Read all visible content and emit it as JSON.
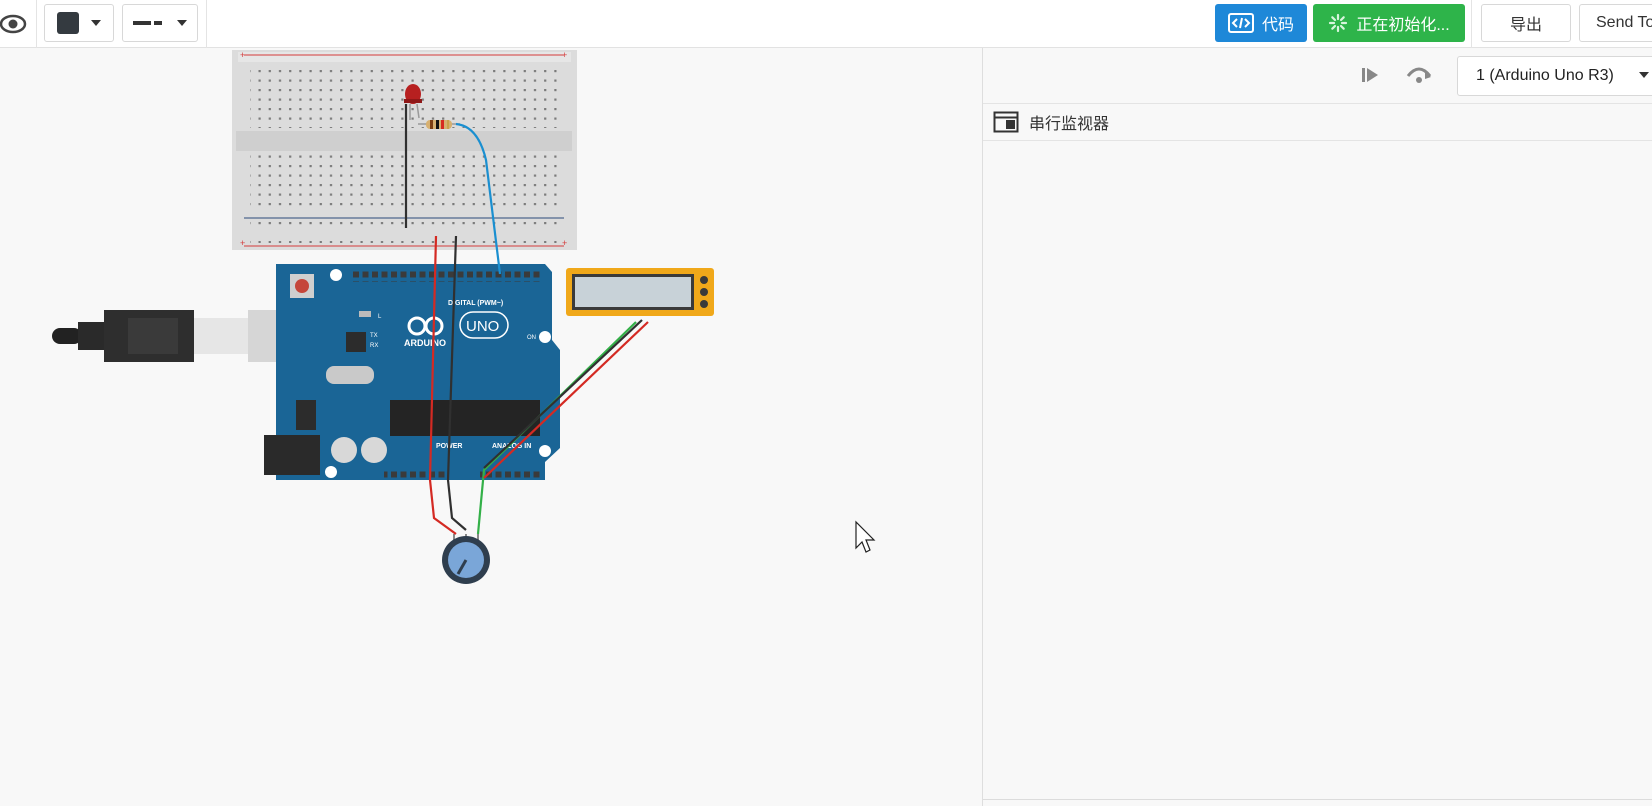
{
  "toolbar": {
    "code_label": "代码",
    "simulate_label": "正在初始化...",
    "export_label": "导出",
    "send_label": "Send To"
  },
  "simulator": {
    "board_select_value": "1 (Arduino Uno R3)",
    "serial_monitor_label": "串行监视器"
  },
  "board": {
    "logo_text": "ARDUINO",
    "uno_text": "UNO",
    "digital_label": "DIGITAL (PWM~)",
    "power_label": "POWER",
    "analog_label": "ANALOG IN",
    "on_label": "ON",
    "l_label": "L",
    "tx_label": "TX",
    "rx_label": "RX"
  },
  "colors": {
    "board_blue": "#1a6596",
    "wire_red": "#d42a23",
    "wire_black": "#303030",
    "wire_blue": "#1a8fd0",
    "wire_green": "#33b048",
    "lcd_frame": "#f0a81a",
    "accent_code": "#1e88d8",
    "accent_start": "#2eb44a"
  },
  "icons": [
    "eye-icon",
    "fill-color-icon",
    "line-style-icon",
    "code-icon",
    "loading-spinner-icon",
    "restart-icon",
    "step-icon",
    "dropdown-arrow-icon",
    "serial-monitor-icon",
    "mouse-cursor-icon"
  ]
}
